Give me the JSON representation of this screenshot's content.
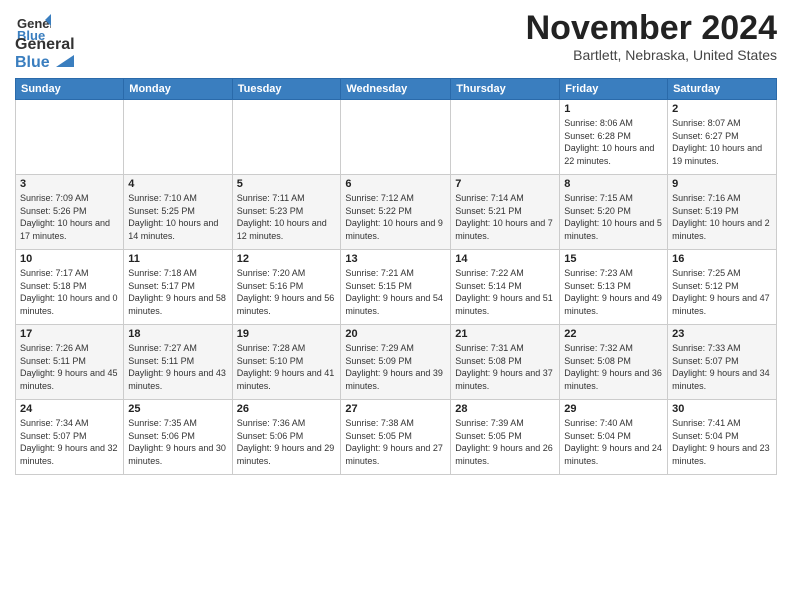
{
  "header": {
    "logo_line1": "General",
    "logo_line2": "Blue",
    "month_year": "November 2024",
    "location": "Bartlett, Nebraska, United States"
  },
  "weekdays": [
    "Sunday",
    "Monday",
    "Tuesday",
    "Wednesday",
    "Thursday",
    "Friday",
    "Saturday"
  ],
  "weeks": [
    [
      {
        "day": "",
        "info": ""
      },
      {
        "day": "",
        "info": ""
      },
      {
        "day": "",
        "info": ""
      },
      {
        "day": "",
        "info": ""
      },
      {
        "day": "",
        "info": ""
      },
      {
        "day": "1",
        "info": "Sunrise: 8:06 AM\nSunset: 6:28 PM\nDaylight: 10 hours and 22 minutes."
      },
      {
        "day": "2",
        "info": "Sunrise: 8:07 AM\nSunset: 6:27 PM\nDaylight: 10 hours and 19 minutes."
      }
    ],
    [
      {
        "day": "3",
        "info": "Sunrise: 7:09 AM\nSunset: 5:26 PM\nDaylight: 10 hours and 17 minutes."
      },
      {
        "day": "4",
        "info": "Sunrise: 7:10 AM\nSunset: 5:25 PM\nDaylight: 10 hours and 14 minutes."
      },
      {
        "day": "5",
        "info": "Sunrise: 7:11 AM\nSunset: 5:23 PM\nDaylight: 10 hours and 12 minutes."
      },
      {
        "day": "6",
        "info": "Sunrise: 7:12 AM\nSunset: 5:22 PM\nDaylight: 10 hours and 9 minutes."
      },
      {
        "day": "7",
        "info": "Sunrise: 7:14 AM\nSunset: 5:21 PM\nDaylight: 10 hours and 7 minutes."
      },
      {
        "day": "8",
        "info": "Sunrise: 7:15 AM\nSunset: 5:20 PM\nDaylight: 10 hours and 5 minutes."
      },
      {
        "day": "9",
        "info": "Sunrise: 7:16 AM\nSunset: 5:19 PM\nDaylight: 10 hours and 2 minutes."
      }
    ],
    [
      {
        "day": "10",
        "info": "Sunrise: 7:17 AM\nSunset: 5:18 PM\nDaylight: 10 hours and 0 minutes."
      },
      {
        "day": "11",
        "info": "Sunrise: 7:18 AM\nSunset: 5:17 PM\nDaylight: 9 hours and 58 minutes."
      },
      {
        "day": "12",
        "info": "Sunrise: 7:20 AM\nSunset: 5:16 PM\nDaylight: 9 hours and 56 minutes."
      },
      {
        "day": "13",
        "info": "Sunrise: 7:21 AM\nSunset: 5:15 PM\nDaylight: 9 hours and 54 minutes."
      },
      {
        "day": "14",
        "info": "Sunrise: 7:22 AM\nSunset: 5:14 PM\nDaylight: 9 hours and 51 minutes."
      },
      {
        "day": "15",
        "info": "Sunrise: 7:23 AM\nSunset: 5:13 PM\nDaylight: 9 hours and 49 minutes."
      },
      {
        "day": "16",
        "info": "Sunrise: 7:25 AM\nSunset: 5:12 PM\nDaylight: 9 hours and 47 minutes."
      }
    ],
    [
      {
        "day": "17",
        "info": "Sunrise: 7:26 AM\nSunset: 5:11 PM\nDaylight: 9 hours and 45 minutes."
      },
      {
        "day": "18",
        "info": "Sunrise: 7:27 AM\nSunset: 5:11 PM\nDaylight: 9 hours and 43 minutes."
      },
      {
        "day": "19",
        "info": "Sunrise: 7:28 AM\nSunset: 5:10 PM\nDaylight: 9 hours and 41 minutes."
      },
      {
        "day": "20",
        "info": "Sunrise: 7:29 AM\nSunset: 5:09 PM\nDaylight: 9 hours and 39 minutes."
      },
      {
        "day": "21",
        "info": "Sunrise: 7:31 AM\nSunset: 5:08 PM\nDaylight: 9 hours and 37 minutes."
      },
      {
        "day": "22",
        "info": "Sunrise: 7:32 AM\nSunset: 5:08 PM\nDaylight: 9 hours and 36 minutes."
      },
      {
        "day": "23",
        "info": "Sunrise: 7:33 AM\nSunset: 5:07 PM\nDaylight: 9 hours and 34 minutes."
      }
    ],
    [
      {
        "day": "24",
        "info": "Sunrise: 7:34 AM\nSunset: 5:07 PM\nDaylight: 9 hours and 32 minutes."
      },
      {
        "day": "25",
        "info": "Sunrise: 7:35 AM\nSunset: 5:06 PM\nDaylight: 9 hours and 30 minutes."
      },
      {
        "day": "26",
        "info": "Sunrise: 7:36 AM\nSunset: 5:06 PM\nDaylight: 9 hours and 29 minutes."
      },
      {
        "day": "27",
        "info": "Sunrise: 7:38 AM\nSunset: 5:05 PM\nDaylight: 9 hours and 27 minutes."
      },
      {
        "day": "28",
        "info": "Sunrise: 7:39 AM\nSunset: 5:05 PM\nDaylight: 9 hours and 26 minutes."
      },
      {
        "day": "29",
        "info": "Sunrise: 7:40 AM\nSunset: 5:04 PM\nDaylight: 9 hours and 24 minutes."
      },
      {
        "day": "30",
        "info": "Sunrise: 7:41 AM\nSunset: 5:04 PM\nDaylight: 9 hours and 23 minutes."
      }
    ]
  ]
}
